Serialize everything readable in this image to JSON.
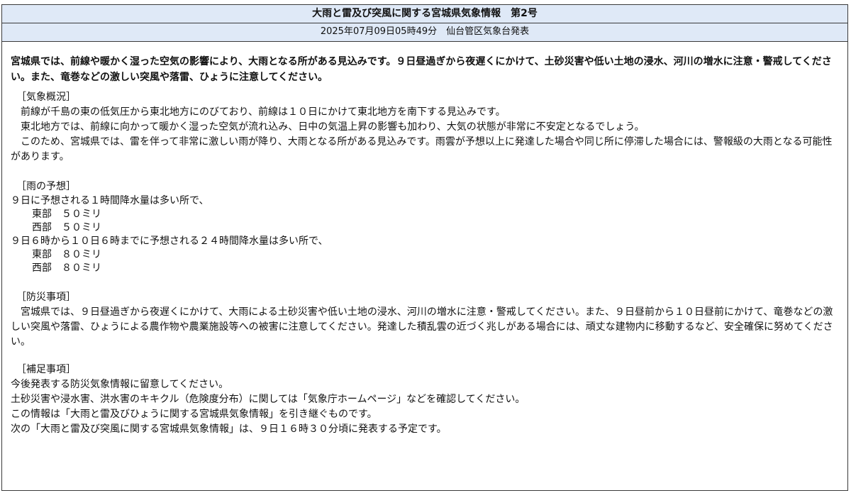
{
  "header": {
    "title": "大雨と雷及び突風に関する宮城県気象情報　第2号",
    "issued": "2025年07月09日05時49分　仙台管区気象台発表"
  },
  "headline": "宮城県では、前線や暖かく湿った空気の影響により、大雨となる所がある見込みです。９日昼過ぎから夜遅くにかけて、土砂災害や低い土地の浸水、河川の増水に注意・警戒してください。また、竜巻などの激しい突風や落雷、ひょうに注意してください。",
  "overview": {
    "title": "［気象概況］",
    "paragraphs": [
      "前線が千島の東の低気圧から東北地方にのびており、前線は１０日にかけて東北地方を南下する見込みです。",
      "東北地方では、前線に向かって暖かく湿った空気が流れ込み、日中の気温上昇の影響も加わり、大気の状態が非常に不安定となるでしょう。",
      "このため、宮城県では、雷を伴って非常に激しい雨が降り、大雨となる所がある見込みです。雨雲が予想以上に発達した場合や同じ所に停滞した場合には、警報級の大雨となる可能性があります。"
    ]
  },
  "rain": {
    "title": "［雨の予想］",
    "hourly_intro": "９日に予想される１時間降水量は多い所で、",
    "hourly": [
      {
        "region": "東部",
        "amount": "５０ミリ"
      },
      {
        "region": "西部",
        "amount": "５０ミリ"
      }
    ],
    "daily_intro": "９日６時から１０日６時までに予想される２４時間降水量は多い所で、",
    "daily": [
      {
        "region": "東部",
        "amount": "８０ミリ"
      },
      {
        "region": "西部",
        "amount": "８０ミリ"
      }
    ]
  },
  "disaster": {
    "title": "［防災事項］",
    "text": "宮城県では、９日昼過ぎから夜遅くにかけて、大雨による土砂災害や低い土地の浸水、河川の増水に注意・警戒してください。また、９日昼前から１０日昼前にかけて、竜巻などの激しい突風や落雷、ひょうによる農作物や農業施設等への被害に注意してください。発達した積乱雲の近づく兆しがある場合には、頑丈な建物内に移動するなど、安全確保に努めてください。"
  },
  "supplement": {
    "title": "［補足事項］",
    "lines": [
      "今後発表する防災気象情報に留意してください。",
      "土砂災害や浸水害、洪水害のキキクル（危険度分布）に関しては「気象庁ホームページ」などを確認してください。",
      "この情報は「大雨と雷及びひょうに関する宮城県気象情報」を引き継ぐものです。",
      "次の「大雨と雷及び突風に関する宮城県気象情報」は、９日１６時３０分頃に発表する予定です。"
    ]
  }
}
